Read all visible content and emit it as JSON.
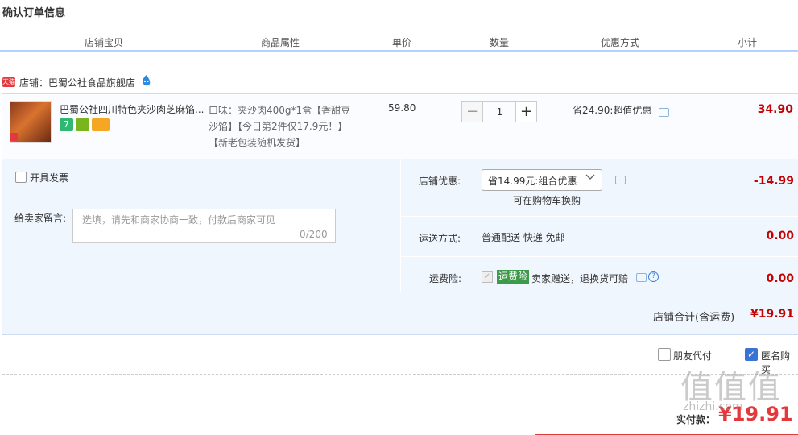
{
  "page": {
    "title": "确认订单信息"
  },
  "header": {
    "columns": [
      "店铺宝贝",
      "商品属性",
      "单价",
      "数量",
      "优惠方式",
      "小计"
    ]
  },
  "shop": {
    "badge": "天猫",
    "name": "店铺：巴蜀公社食品旗舰店"
  },
  "item": {
    "title": "巴蜀公社四川特色夹沙肉芝麻馅...",
    "sku_lines": [
      "口味：夹沙肉400g*1盒【香甜豆",
      "沙馅】【今日第2件仅17.9元！】",
      "【新老包装随机发货】"
    ],
    "price": "59.80",
    "quantity": "1",
    "qty_minus": "−",
    "qty_plus": "+",
    "promo": "省24.90:超值优惠",
    "subtotal": "34.90"
  },
  "options": {
    "invoice_label": "开具发票",
    "message_label": "给卖家留言:",
    "message_placeholder": "选填，请先和商家协商一致，付款后商家可见",
    "message_count": "0/200",
    "shop_discount_label": "店铺优惠:",
    "shop_discount_value": "省14.99元:组合优惠",
    "shop_discount_hint": "可在购物车换购",
    "shop_discount_amount": "-14.99",
    "shipping_label": "运送方式:",
    "shipping_method": "普通配送 快递 免邮",
    "shipping_amount": "0.00",
    "insurance_label": "运费险:",
    "insurance_tag": "运费险",
    "insurance_text": "卖家赠送，退换货可赔",
    "insurance_amount": "0.00"
  },
  "totals": {
    "shop_total_label": "店铺合计(含运费)",
    "shop_total_value": "¥19.91",
    "friend_pay_label": "朋友代付",
    "anonymous_label": "匿名购买",
    "pay_label": "实付款：",
    "pay_value": "¥19.91"
  },
  "watermark": {
    "main": "值值值",
    "sub": "zhizhi.com"
  },
  "colors": {
    "price_red": "#c40000",
    "accent_blue": "#3a73d4",
    "panel_bg": "#f0f6fd"
  }
}
